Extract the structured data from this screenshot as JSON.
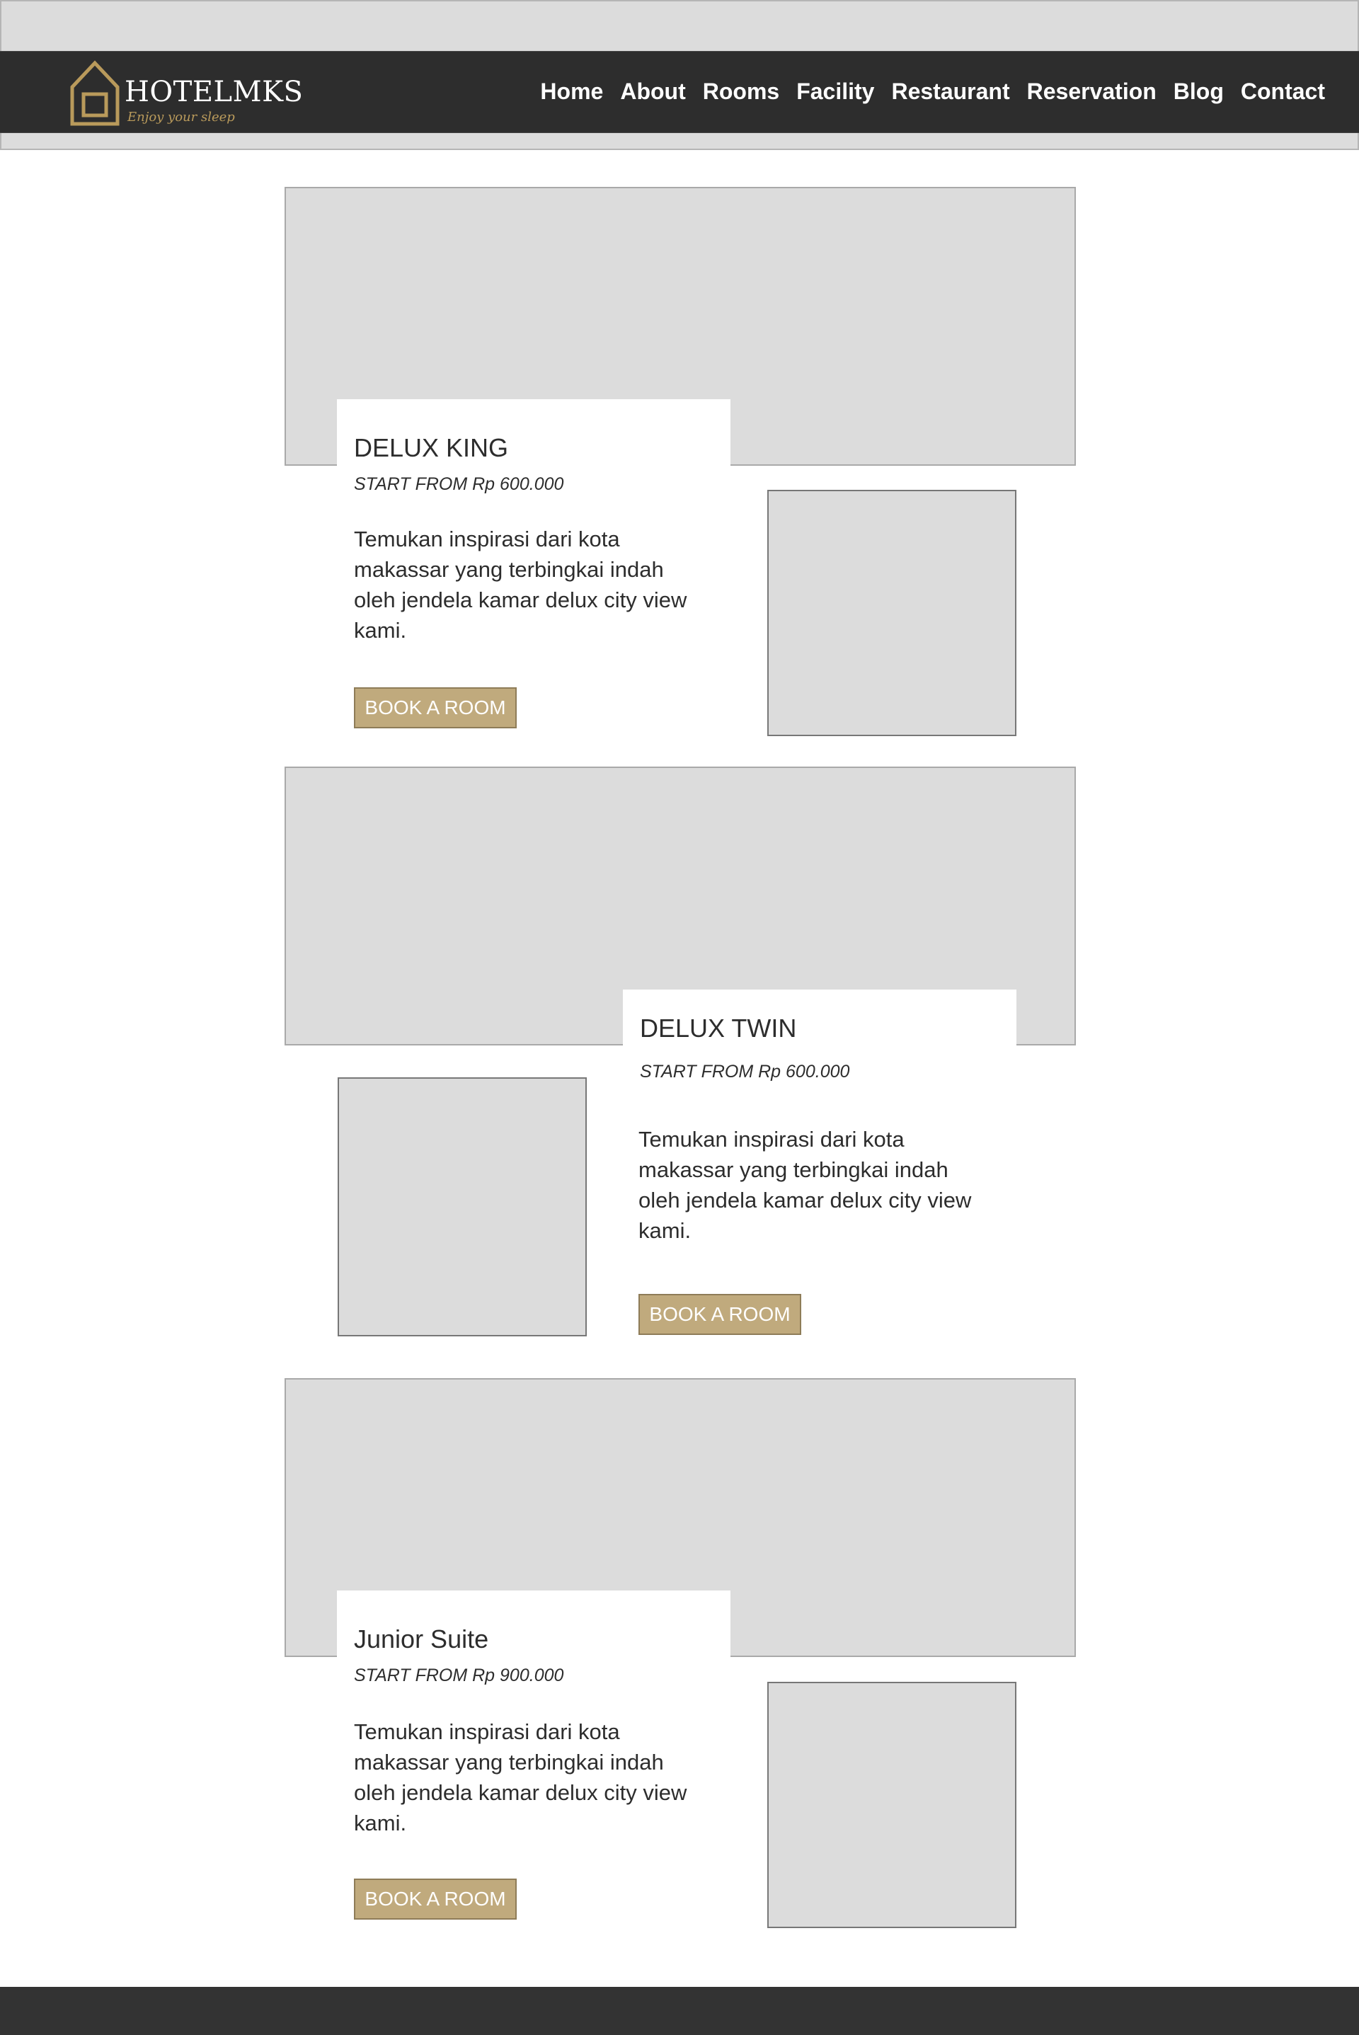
{
  "header": {
    "logo_text": "HOTELMKS",
    "logo_tagline": "Enjoy your sleep",
    "nav": [
      {
        "label": "Home"
      },
      {
        "label": "About"
      },
      {
        "label": "Rooms"
      },
      {
        "label": "Facility"
      },
      {
        "label": "Restaurant"
      },
      {
        "label": "Reservation"
      },
      {
        "label": "Blog"
      },
      {
        "label": "Contact"
      }
    ]
  },
  "rooms": [
    {
      "name": "DELUX KING",
      "price": "START FROM Rp 600.000",
      "description": "Temukan inspirasi dari kota makassar yang terbingkai indah oleh jendela kamar delux city view kami.",
      "button": "BOOK  A ROOM"
    },
    {
      "name": "DELUX TWIN",
      "price": "START FROM Rp 600.000",
      "description": "Temukan inspirasi dari kota makassar yang terbingkai indah oleh jendela kamar delux city view kami.",
      "button": "BOOK  A ROOM"
    },
    {
      "name": "Junior Suite",
      "price": "START FROM Rp 900.000",
      "description": "Temukan inspirasi dari kota makassar yang terbingkai indah oleh jendela kamar delux city view kami.",
      "button": "BOOK  A ROOM"
    }
  ],
  "colors": {
    "nav_background": "#2d2d2d",
    "accent_gold": "#c0aa7d",
    "placeholder_gray": "#dcdcdc",
    "footer": "#333333"
  }
}
